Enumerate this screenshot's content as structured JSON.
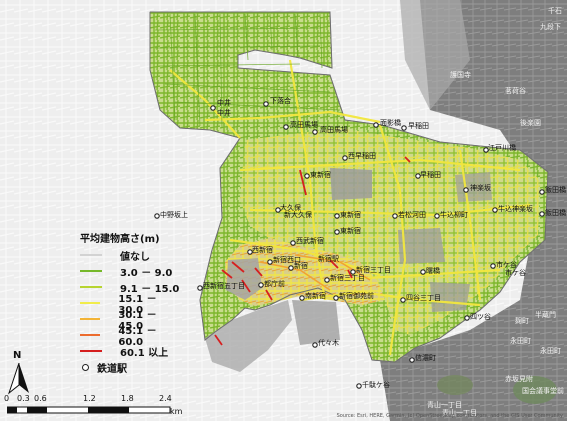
{
  "legend": {
    "title": "平均建物高さ(m)",
    "items": [
      {
        "label": "値なし",
        "color": "#d2d2d2"
      },
      {
        "label": "3.0 －  9.0",
        "color": "#76b82a"
      },
      {
        "label": "9.1 － 15.0",
        "color": "#b7d431"
      },
      {
        "label": "15.1 － 30.0",
        "color": "#f1ec4a"
      },
      {
        "label": "30.1 － 45.0",
        "color": "#f3b437"
      },
      {
        "label": "45.1 － 60.0",
        "color": "#ec6b2d"
      },
      {
        "label": "60.1  以上",
        "color": "#d51e1e"
      }
    ],
    "station_label": "鉄道駅"
  },
  "north_label": "N",
  "scale": {
    "ticks": [
      "0",
      "0.3",
      "0.6",
      "1.2",
      "1.8",
      "2.4"
    ],
    "unit": "km"
  },
  "place_labels": [
    {
      "text": "中井",
      "style": "sta"
    },
    {
      "text": "中井",
      "style": "sta"
    },
    {
      "text": "下落合",
      "style": "sta"
    },
    {
      "text": "高田馬場",
      "style": "sta"
    },
    {
      "text": "高田馬場",
      "style": "sta"
    },
    {
      "text": "面影橋",
      "style": "sta"
    },
    {
      "text": "早稲田",
      "style": "sta"
    },
    {
      "text": "西早稲田",
      "style": "sta"
    },
    {
      "text": "早稲田",
      "style": "sta"
    },
    {
      "text": "江戸川橋",
      "style": "sta"
    },
    {
      "text": "神楽坂",
      "style": "sta"
    },
    {
      "text": "飯田橋",
      "style": "sta"
    },
    {
      "text": "飯田橋",
      "style": "sta"
    },
    {
      "text": "大久保",
      "style": "sta"
    },
    {
      "text": "新大久保",
      "style": "sta"
    },
    {
      "text": "東新宿",
      "style": "sta"
    },
    {
      "text": "若松河田",
      "style": "sta"
    },
    {
      "text": "牛込柳町",
      "style": "sta"
    },
    {
      "text": "牛込神楽坂",
      "style": "sta"
    },
    {
      "text": "西武新宿",
      "style": "sta"
    },
    {
      "text": "東新宿",
      "style": "sta"
    },
    {
      "text": "西新宿",
      "style": "sta"
    },
    {
      "text": "新宿西口",
      "style": "sta"
    },
    {
      "text": "新宿",
      "style": "sta"
    },
    {
      "text": "新宿三丁目",
      "style": "sta"
    },
    {
      "text": "新宿三丁目",
      "style": "sta"
    },
    {
      "text": "曙橋",
      "style": "sta"
    },
    {
      "text": "市ケ谷",
      "style": "sta"
    },
    {
      "text": "市ケ谷",
      "style": "sta"
    },
    {
      "text": "都庁前",
      "style": "sta"
    },
    {
      "text": "西新宿五丁目",
      "style": "sta"
    },
    {
      "text": "南新宿",
      "style": "sta"
    },
    {
      "text": "新宿御苑前",
      "style": "sta"
    },
    {
      "text": "四谷三丁目",
      "style": "sta"
    },
    {
      "text": "四ツ谷",
      "style": "sta"
    },
    {
      "text": "信濃町",
      "style": "sta"
    },
    {
      "text": "代々木",
      "style": "sta"
    },
    {
      "text": "千駄ケ谷",
      "style": "sta"
    },
    {
      "text": "千石",
      "style": "dark"
    },
    {
      "text": "護国寺",
      "style": "dark"
    },
    {
      "text": "茗荷谷",
      "style": "dark"
    },
    {
      "text": "後楽園",
      "style": "dark"
    },
    {
      "text": "新宿駅",
      "style": "sta"
    },
    {
      "text": "東新宿",
      "style": "sta"
    },
    {
      "text": "半蔵門",
      "style": "dark"
    },
    {
      "text": "永田町",
      "style": "dark"
    },
    {
      "text": "永田町",
      "style": "dark"
    },
    {
      "text": "赤坂見附",
      "style": "dark"
    },
    {
      "text": "国会議事堂前",
      "style": "dark"
    },
    {
      "text": "麹町",
      "style": "dark"
    },
    {
      "text": "青山一丁目",
      "style": "dark"
    },
    {
      "text": "青山一丁目",
      "style": "dark"
    },
    {
      "text": "中野坂上",
      "style": "sta"
    },
    {
      "text": "九段下",
      "style": "dark"
    }
  ],
  "credit": "Source: Esri, HERE, Garmin, (c) OpenStreetMap contributors, and the GIS User Community"
}
